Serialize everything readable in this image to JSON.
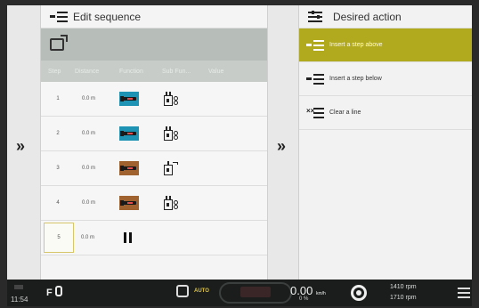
{
  "left_panel": {
    "title": "Edit sequence",
    "columns": [
      "Step",
      "Distance",
      "Function",
      "Sub Fun...",
      "Value"
    ],
    "rows": [
      {
        "step": "1",
        "distance": "0.0 m",
        "function_color": "blue",
        "sub_icon": "cylinder-icon"
      },
      {
        "step": "2",
        "distance": "0.0 m",
        "function_color": "blue",
        "sub_icon": "cylinder-icon"
      },
      {
        "step": "3",
        "distance": "0.0 m",
        "function_color": "brown",
        "sub_icon": "cylinder-hook-icon"
      },
      {
        "step": "4",
        "distance": "0.0 m",
        "function_color": "brown",
        "sub_icon": "cylinder-icon"
      },
      {
        "step": "5",
        "distance": "0.0 m",
        "function_color": "none",
        "sub_icon": "pause-icon"
      }
    ]
  },
  "right_panel": {
    "title": "Desired action",
    "actions": [
      {
        "label": "Insert a step above",
        "active": true
      },
      {
        "label": "Insert a step below",
        "active": false
      },
      {
        "label": "Clear a line",
        "active": false
      }
    ]
  },
  "status_bar": {
    "time": "11:54",
    "mode": "AUTO",
    "speed": "0.00",
    "speed_unit": "km/h",
    "slip": "0 %",
    "rpm_1": "1410 rpm",
    "rpm_2": "1710 rpm"
  },
  "colors": {
    "accent_yellow": "#b2aa1e",
    "function_blue": "#1e93b4",
    "function_brown": "#a0622e"
  }
}
